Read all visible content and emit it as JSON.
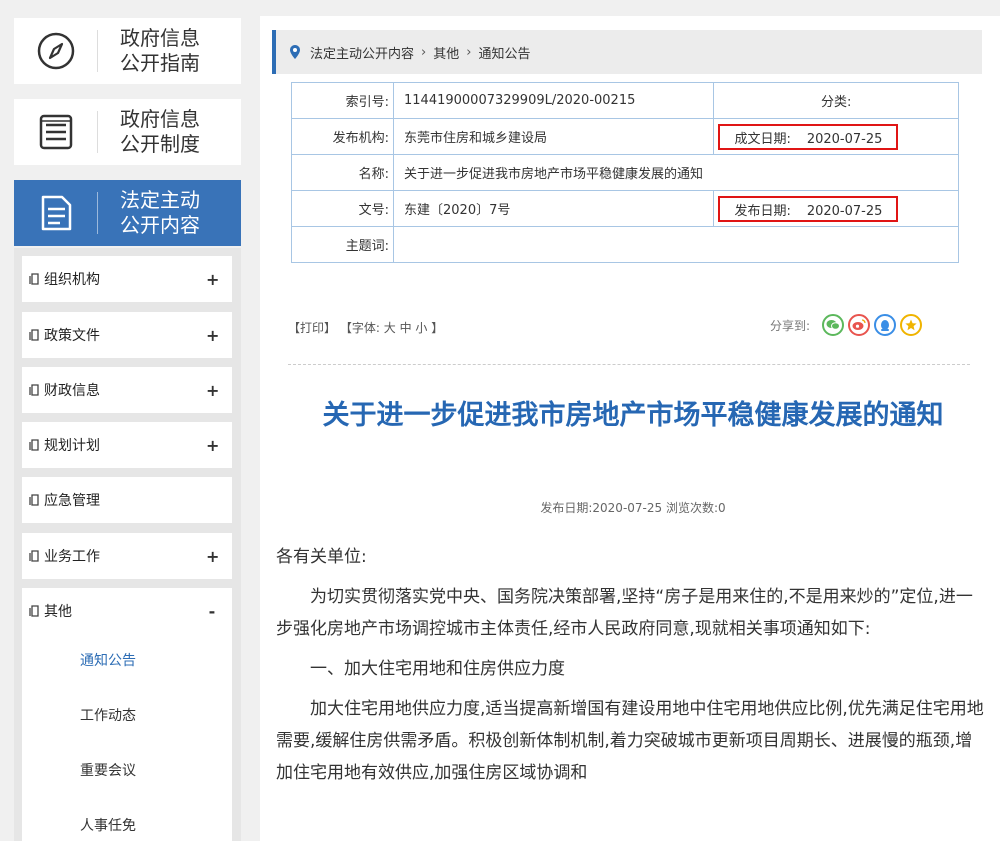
{
  "sidebar": {
    "cards": [
      {
        "line1": "政府信息",
        "line2": "公开指南",
        "icon": "compass-icon"
      },
      {
        "line1": "政府信息",
        "line2": "公开制度",
        "icon": "list-icon"
      },
      {
        "line1": "法定主动",
        "line2": "公开内容",
        "icon": "document-icon"
      }
    ],
    "menu": [
      {
        "label": "组织机构",
        "toggle": "+"
      },
      {
        "label": "政策文件",
        "toggle": "+"
      },
      {
        "label": "财政信息",
        "toggle": "+"
      },
      {
        "label": "规划计划",
        "toggle": "+"
      },
      {
        "label": "应急管理",
        "toggle": ""
      },
      {
        "label": "业务工作",
        "toggle": "+"
      },
      {
        "label": "其他",
        "toggle": "-"
      }
    ],
    "submenu": [
      "通知公告",
      "工作动态",
      "重要会议",
      "人事任免"
    ]
  },
  "breadcrumb": {
    "items": [
      "法定主动公开内容",
      "其他",
      "通知公告"
    ],
    "sep": "›"
  },
  "meta": {
    "index_label": "索引号:",
    "index_value": "11441900007329909L/2020-00215",
    "category_label": "分类:",
    "category_value": "",
    "org_label": "发布机构:",
    "org_value": "东莞市住房和城乡建设局",
    "written_label": "成文日期:",
    "written_value": "2020-07-25",
    "name_label": "名称:",
    "name_value": "关于进一步促进我市房地产市场平稳健康发展的通知",
    "docno_label": "文号:",
    "docno_value": "东建〔2020〕7号",
    "publish_label": "发布日期:",
    "publish_value": "2020-07-25",
    "subject_label": "主题词:",
    "subject_value": ""
  },
  "tools": {
    "print": "【打印】",
    "font_prefix": "【字体:",
    "large": "大",
    "medium": "中",
    "small": "小",
    "font_suffix": "】",
    "share_label": "分享到:"
  },
  "article": {
    "title": "关于进一步促进我市房地产市场平稳健康发展的通知",
    "pubinfo": "发布日期:2020-07-25  浏览次数:0",
    "paragraphs": [
      "各有关单位:",
      "为切实贯彻落实党中央、国务院决策部署,坚持“房子是用来住的,不是用来炒的”定位,进一步强化房地产市场调控城市主体责任,经市人民政府同意,现就相关事项通知如下:",
      "一、加大住宅用地和住房供应力度",
      "加大住宅用地供应力度,适当提高新增国有建设用地中住宅用地供应比例,优先满足住宅用地需要,缓解住房供需矛盾。积极创新体制机制,着力突破城市更新项目周期长、进展慢的瓶颈,增加住宅用地有效供应,加强住房区域协调和"
    ]
  },
  "colors": {
    "accent": "#2d6db5",
    "active_card": "#3973b8",
    "highlight_border": "#e01515",
    "title": "#2667b3"
  }
}
